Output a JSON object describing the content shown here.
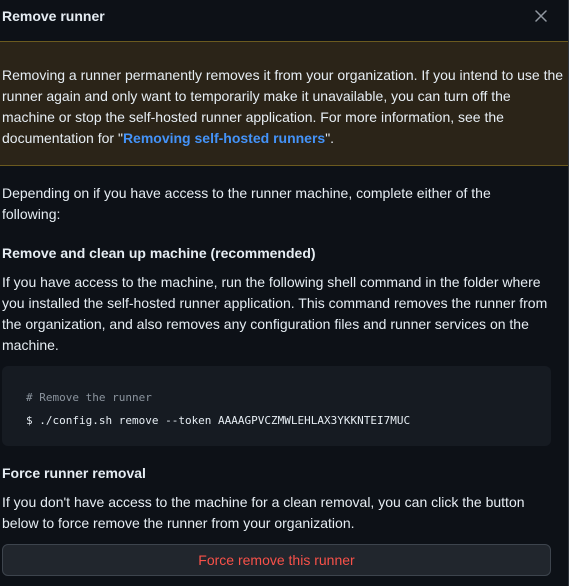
{
  "dialog": {
    "title": "Remove runner",
    "close_icon": "close-icon"
  },
  "warning": {
    "text_before": "Removing a runner permanently removes it from your organization. If you intend to use the runner again and only want to temporarily make it unavailable, you can turn off the machine or stop the self-hosted runner application. For more information, see the documentation for \"",
    "link_text": "Removing self-hosted runners",
    "text_after": "\"."
  },
  "intro": "Depending on if you have access to the runner machine, complete either of the following:",
  "remove_section": {
    "heading": "Remove and clean up machine (recommended)",
    "description": "If you have access to the machine, run the following shell command in the folder where you installed the self-hosted runner application. This command removes the runner from the organization, and also removes any configuration files and runner services on the machine.",
    "code_comment": "# Remove the runner",
    "code_command": "$ ./config.sh remove --token AAAAGPVCZMWLEHLAX3YKKNTEI7MUC"
  },
  "force_section": {
    "heading": "Force runner removal",
    "description": "If you don't have access to the machine for a clean removal, you can click the button below to force remove the runner from your organization.",
    "button_label": "Force remove this runner"
  },
  "colors": {
    "background": "#0d1117",
    "warning_bg": "#2b2418",
    "link": "#4493f8",
    "danger": "#f85149"
  }
}
